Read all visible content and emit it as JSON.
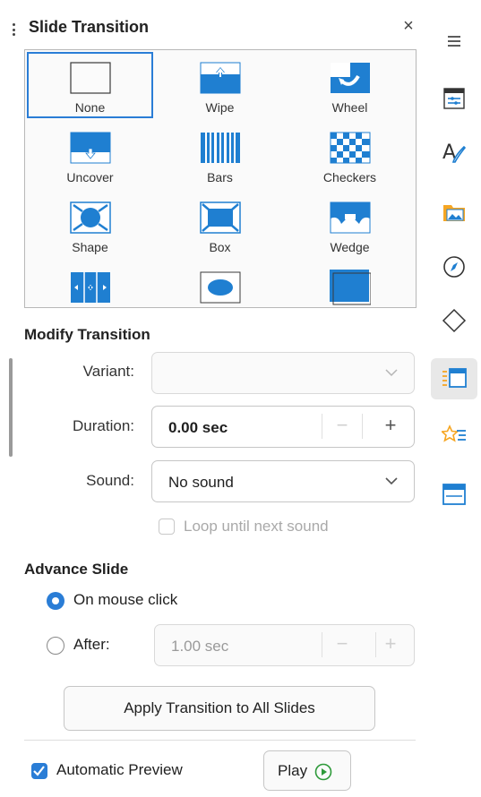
{
  "header": {
    "title": "Slide Transition",
    "close_symbol": "×"
  },
  "transitions": [
    {
      "label": "None",
      "icon": "none-icon",
      "selected": true
    },
    {
      "label": "Wipe",
      "icon": "wipe-icon",
      "selected": false
    },
    {
      "label": "Wheel",
      "icon": "wheel-icon",
      "selected": false
    },
    {
      "label": "Uncover",
      "icon": "uncover-icon",
      "selected": false
    },
    {
      "label": "Bars",
      "icon": "bars-icon",
      "selected": false
    },
    {
      "label": "Checkers",
      "icon": "checkers-icon",
      "selected": false
    },
    {
      "label": "Shape",
      "icon": "shape-icon",
      "selected": false
    },
    {
      "label": "Box",
      "icon": "box-icon",
      "selected": false
    },
    {
      "label": "Wedge",
      "icon": "wedge-icon",
      "selected": false
    },
    {
      "label": "",
      "icon": "split-icon",
      "selected": false
    },
    {
      "label": "",
      "icon": "oval-icon",
      "selected": false
    },
    {
      "label": "",
      "icon": "fade-icon",
      "selected": false
    }
  ],
  "modify": {
    "heading": "Modify Transition",
    "variant_label": "Variant:",
    "variant_value": "",
    "duration_label": "Duration:",
    "duration_value": "0.00 sec",
    "minus": "−",
    "plus": "+",
    "sound_label": "Sound:",
    "sound_value": "No sound",
    "loop_label": "Loop until next sound",
    "loop_checked": false
  },
  "advance": {
    "heading": "Advance Slide",
    "on_click_label": "On mouse click",
    "on_click_selected": true,
    "after_label": "After:",
    "after_value": "1.00 sec"
  },
  "buttons": {
    "apply_all": "Apply Transition to All Slides",
    "play": "Play"
  },
  "preview": {
    "label": "Automatic Preview",
    "checked": true
  },
  "sidebar": {
    "icons": [
      "menu-icon",
      "properties-icon",
      "styles-icon",
      "gallery-icon",
      "navigator-icon",
      "shapes-icon",
      "slide-transition-icon",
      "animation-icon",
      "master-slides-icon"
    ],
    "active": "slide-transition-icon"
  },
  "colors": {
    "accent": "#2a7dd6",
    "icon_blue": "#1f7fd1"
  }
}
